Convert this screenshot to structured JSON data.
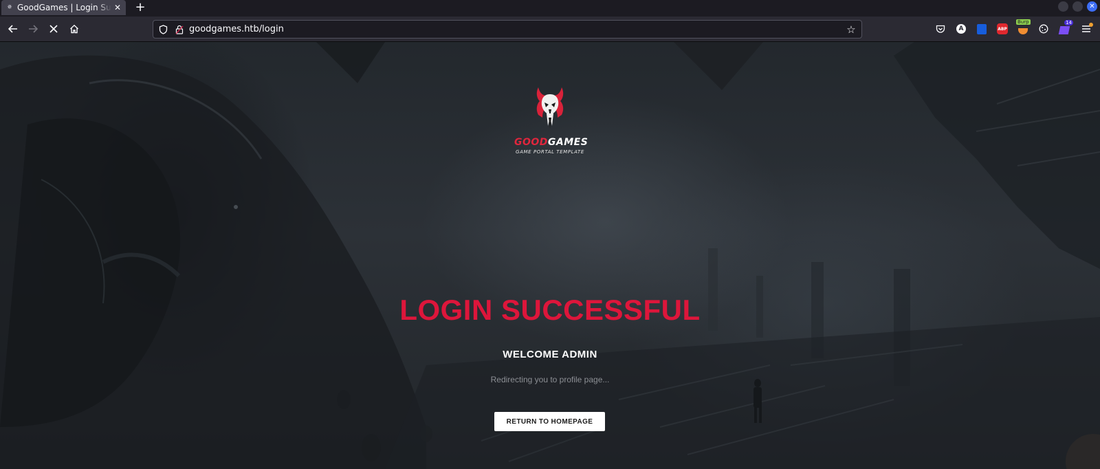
{
  "browser": {
    "tab": {
      "title": "GoodGames | Login Successful",
      "favicon": "spider-favicon-icon",
      "close_glyph": "✕"
    },
    "new_tab_glyph": "+",
    "url": "goodgames.htb/login",
    "extensions": [
      {
        "name": "pocket-icon",
        "label": ""
      },
      {
        "name": "a-extension-icon",
        "label": "A"
      },
      {
        "name": "bitwarden-icon",
        "label": ""
      },
      {
        "name": "abp-icon",
        "label": "ABP"
      },
      {
        "name": "burp-icon",
        "label": "Burp"
      },
      {
        "name": "cookie-icon",
        "label": ""
      },
      {
        "name": "wappalyzer-icon",
        "label": "14"
      },
      {
        "name": "menu-icon",
        "label": ""
      }
    ]
  },
  "page": {
    "logo": {
      "name_part1": "GOOD",
      "name_part2": "GAMES",
      "subtitle": "GAME PORTAL TEMPLATE"
    },
    "headline": "LOGIN SUCCESSFUL",
    "welcome": "WELCOME ADMIN",
    "redirect_text": "Redirecting you to profile page...",
    "return_button": "RETURN TO HOMEPAGE"
  },
  "colors": {
    "accent": "#dd163b",
    "button_bg": "#ffffff",
    "muted_text": "#8c8f94"
  }
}
